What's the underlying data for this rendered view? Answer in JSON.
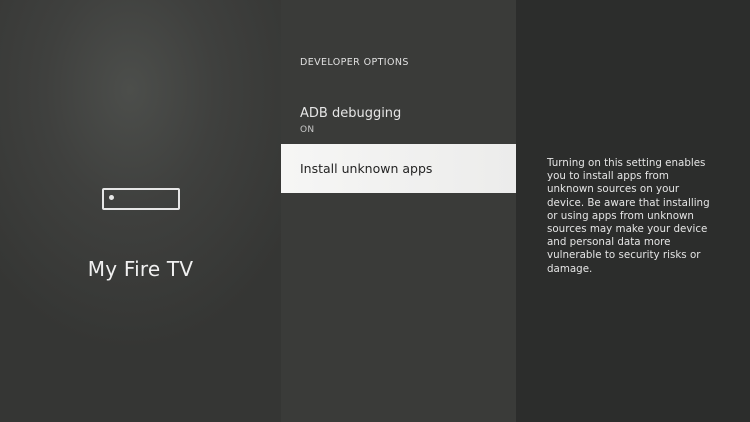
{
  "device_panel": {
    "title": "My Fire TV",
    "icon": "fire-tv-device-icon"
  },
  "menu": {
    "heading": "DEVELOPER OPTIONS",
    "items": [
      {
        "label": "ADB debugging",
        "value": "ON"
      },
      {
        "label": "Install unknown apps",
        "value": ""
      }
    ],
    "selected_index": 1
  },
  "detail": {
    "description": "Turning on this setting enables you to install apps from unknown sources on your device. Be aware that installing or using apps from unknown sources may make your device and personal data more vulnerable to security risks or damage."
  },
  "colors": {
    "background": "#2b2c2b",
    "selected_item_bg": "#f2f2f1",
    "text": "#e8e8e8"
  }
}
